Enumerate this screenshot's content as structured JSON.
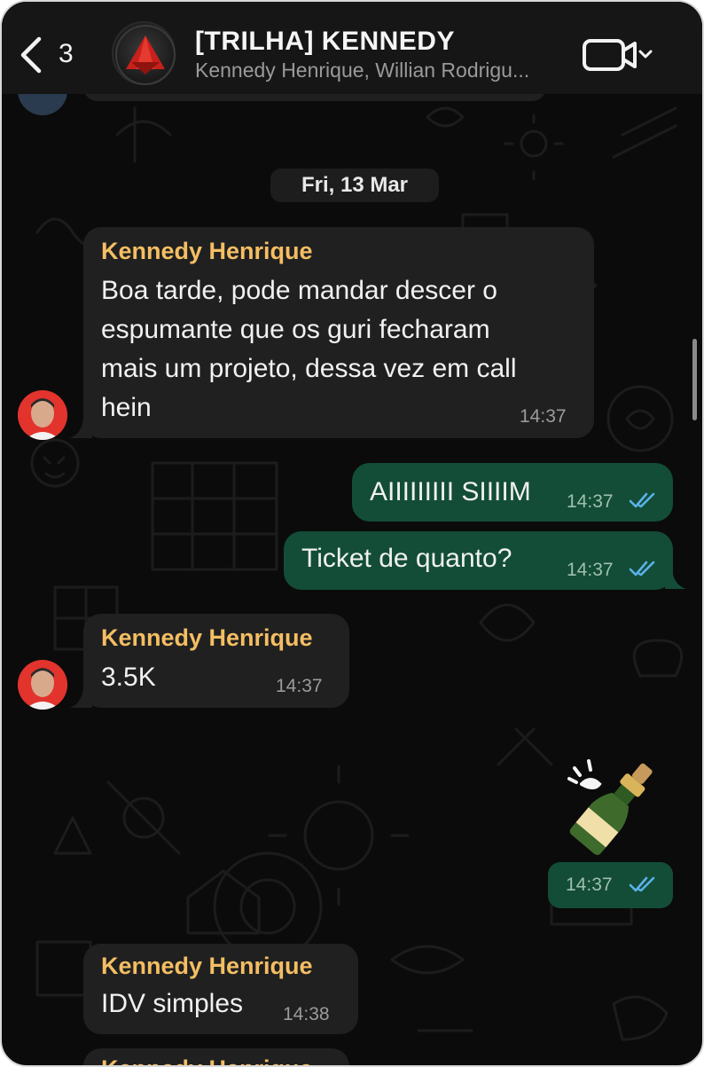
{
  "header": {
    "back_count": "3",
    "title": "[TRILHA] KENNEDY",
    "subtitle": "Kennedy Henrique, Willian Rodrigu..."
  },
  "date_separator": "Fri, 13 Mar",
  "messages": [
    {
      "direction": "incoming",
      "sender": "Kennedy Henrique",
      "lines": [
        "Boa tarde, pode mandar descer o",
        "espumante que os guri fecharam",
        "mais um projeto, dessa vez em call",
        "hein"
      ],
      "time": "14:37"
    },
    {
      "direction": "outgoing",
      "text": "AIIIIIIIII SIIIIM",
      "time": "14:37",
      "status": "read"
    },
    {
      "direction": "outgoing",
      "text": "Ticket de quanto?",
      "time": "14:37",
      "status": "read"
    },
    {
      "direction": "incoming",
      "sender": "Kennedy Henrique",
      "text": "3.5K",
      "time": "14:37"
    },
    {
      "direction": "outgoing",
      "sticker": "champagne-bottle",
      "time": "14:37",
      "status": "read"
    },
    {
      "direction": "incoming",
      "sender": "Kennedy Henrique",
      "text": "IDV simples",
      "time": "14:38"
    },
    {
      "direction": "incoming",
      "sender": "Kennedy Henrique",
      "partial": true
    }
  ],
  "colors": {
    "background": "#0b0b0b",
    "header": "#161616",
    "incoming_bubble": "#202020",
    "outgoing_bubble": "#134d37",
    "sender_name": "#f4be63",
    "read_ticks": "#5ab2e8"
  },
  "icons": [
    "chevron-left-icon",
    "video-camera-icon",
    "chevron-down-icon",
    "double-check-icon",
    "champagne-sticker"
  ]
}
